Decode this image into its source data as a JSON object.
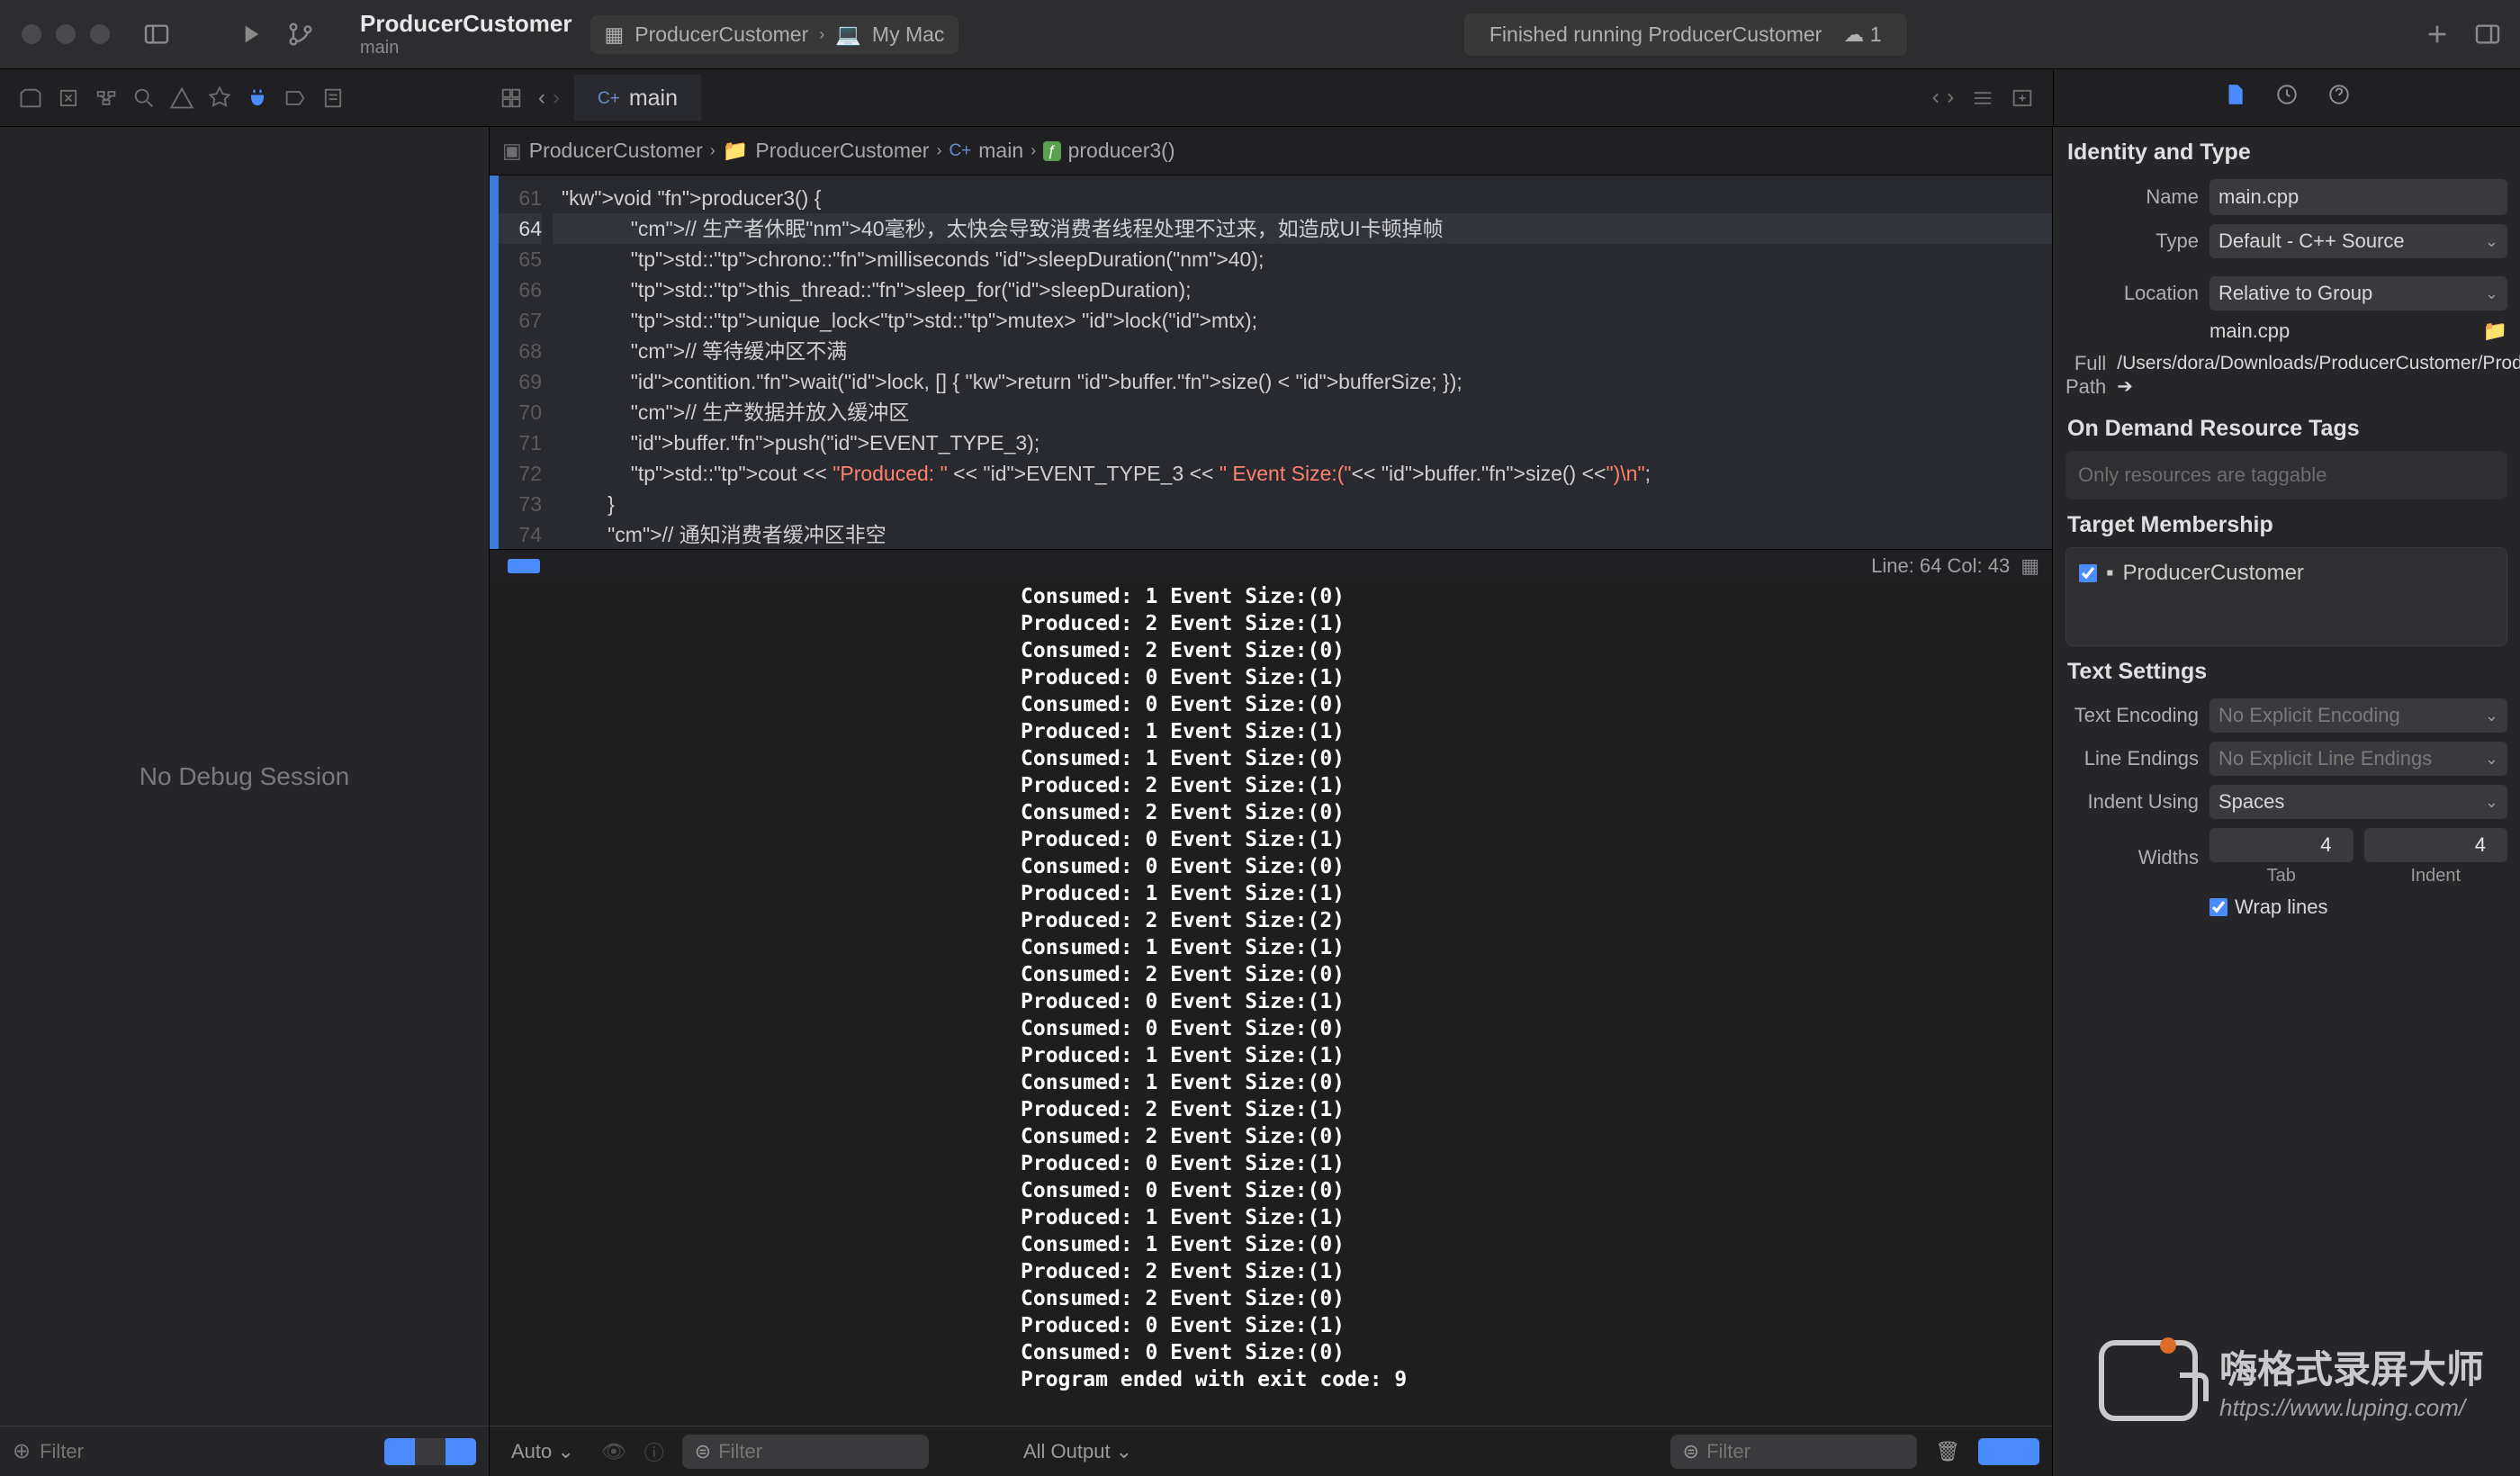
{
  "titlebar": {
    "project": "ProducerCustomer",
    "branch": "main",
    "scheme": "ProducerCustomer",
    "target": "My Mac",
    "status": "Finished running ProducerCustomer",
    "cloud_count": "1"
  },
  "tab": {
    "label": "main"
  },
  "jumpbar": {
    "p0": "ProducerCustomer",
    "p1": "ProducerCustomer",
    "p2": "main",
    "p3": "producer3()",
    "prefix2": "C+"
  },
  "editor": {
    "lines": [
      {
        "n": "61",
        "t": "void producer3() {"
      },
      {
        "n": "64",
        "t": "            // 生产者休眠40毫秒，太快会导致消费者线程处理不过来，如造成UI卡顿掉帧",
        "hl": true
      },
      {
        "n": "65",
        "t": "            std::chrono::milliseconds sleepDuration(40);"
      },
      {
        "n": "66",
        "t": "            std::this_thread::sleep_for(sleepDuration);"
      },
      {
        "n": "67",
        "t": "            std::unique_lock<std::mutex> lock(mtx);"
      },
      {
        "n": "68",
        "t": "            // 等待缓冲区不满"
      },
      {
        "n": "69",
        "t": "            contition.wait(lock, [] { return buffer.size() < bufferSize; });"
      },
      {
        "n": "70",
        "t": "            // 生产数据并放入缓冲区"
      },
      {
        "n": "71",
        "t": "            buffer.push(EVENT_TYPE_3);"
      },
      {
        "n": "72",
        "t": "            std::cout << \"Produced: \" << EVENT_TYPE_3 << \" Event Size:(\"<< buffer.size() <<\")\\n\";"
      },
      {
        "n": "73",
        "t": "        }"
      },
      {
        "n": "74",
        "t": "        // 通知消费者缓冲区非空"
      }
    ],
    "cursor": "Line: 64  Col: 43"
  },
  "console": {
    "lines": [
      "Consumed: 1 Event Size:(0)",
      "Produced: 2 Event Size:(1)",
      "Consumed: 2 Event Size:(0)",
      "Produced: 0 Event Size:(1)",
      "Consumed: 0 Event Size:(0)",
      "Produced: 1 Event Size:(1)",
      "Consumed: 1 Event Size:(0)",
      "Produced: 2 Event Size:(1)",
      "Consumed: 2 Event Size:(0)",
      "Produced: 0 Event Size:(1)",
      "Consumed: 0 Event Size:(0)",
      "Produced: 1 Event Size:(1)",
      "Produced: 2 Event Size:(2)",
      "Consumed: 1 Event Size:(1)",
      "Consumed: 2 Event Size:(0)",
      "Produced: 0 Event Size:(1)",
      "Consumed: 0 Event Size:(0)",
      "Produced: 1 Event Size:(1)",
      "Consumed: 1 Event Size:(0)",
      "Produced: 2 Event Size:(1)",
      "Consumed: 2 Event Size:(0)",
      "Produced: 0 Event Size:(1)",
      "Consumed: 0 Event Size:(0)",
      "Produced: 1 Event Size:(1)",
      "Consumed: 1 Event Size:(0)",
      "Produced: 2 Event Size:(1)",
      "Consumed: 2 Event Size:(0)",
      "Produced: 0 Event Size:(1)",
      "Consumed: 0 Event Size:(0)",
      "Program ended with exit code: 9"
    ],
    "auto": "Auto ⌄",
    "alloutput": "All Output ⌄",
    "filter": "Filter"
  },
  "navigator": {
    "empty": "No Debug Session",
    "filter": "Filter"
  },
  "inspector": {
    "identity_h": "Identity and Type",
    "name_lbl": "Name",
    "name_val": "main.cpp",
    "type_lbl": "Type",
    "type_val": "Default - C++ Source",
    "loc_lbl": "Location",
    "loc_val": "Relative to Group",
    "file_val": "main.cpp",
    "fullpath_lbl": "Full Path",
    "fullpath_val": "/Users/dora/Downloads/ProducerCustomer/ProducerCustomer/main.cpp",
    "odr_h": "On Demand Resource Tags",
    "odr_ph": "Only resources are taggable",
    "tm_h": "Target Membership",
    "tm_item": "ProducerCustomer",
    "ts_h": "Text Settings",
    "enc_lbl": "Text Encoding",
    "enc_val": "No Explicit Encoding",
    "le_lbl": "Line Endings",
    "le_val": "No Explicit Line Endings",
    "iu_lbl": "Indent Using",
    "iu_val": "Spaces",
    "w_lbl": "Widths",
    "w_tab": "4",
    "w_ind": "4",
    "w_tab_lbl": "Tab",
    "w_ind_lbl": "Indent",
    "wrap_lbl": "Wrap lines"
  },
  "watermark": {
    "t1": "嗨格式录屏大师",
    "t2": "https://www.luping.com/"
  }
}
